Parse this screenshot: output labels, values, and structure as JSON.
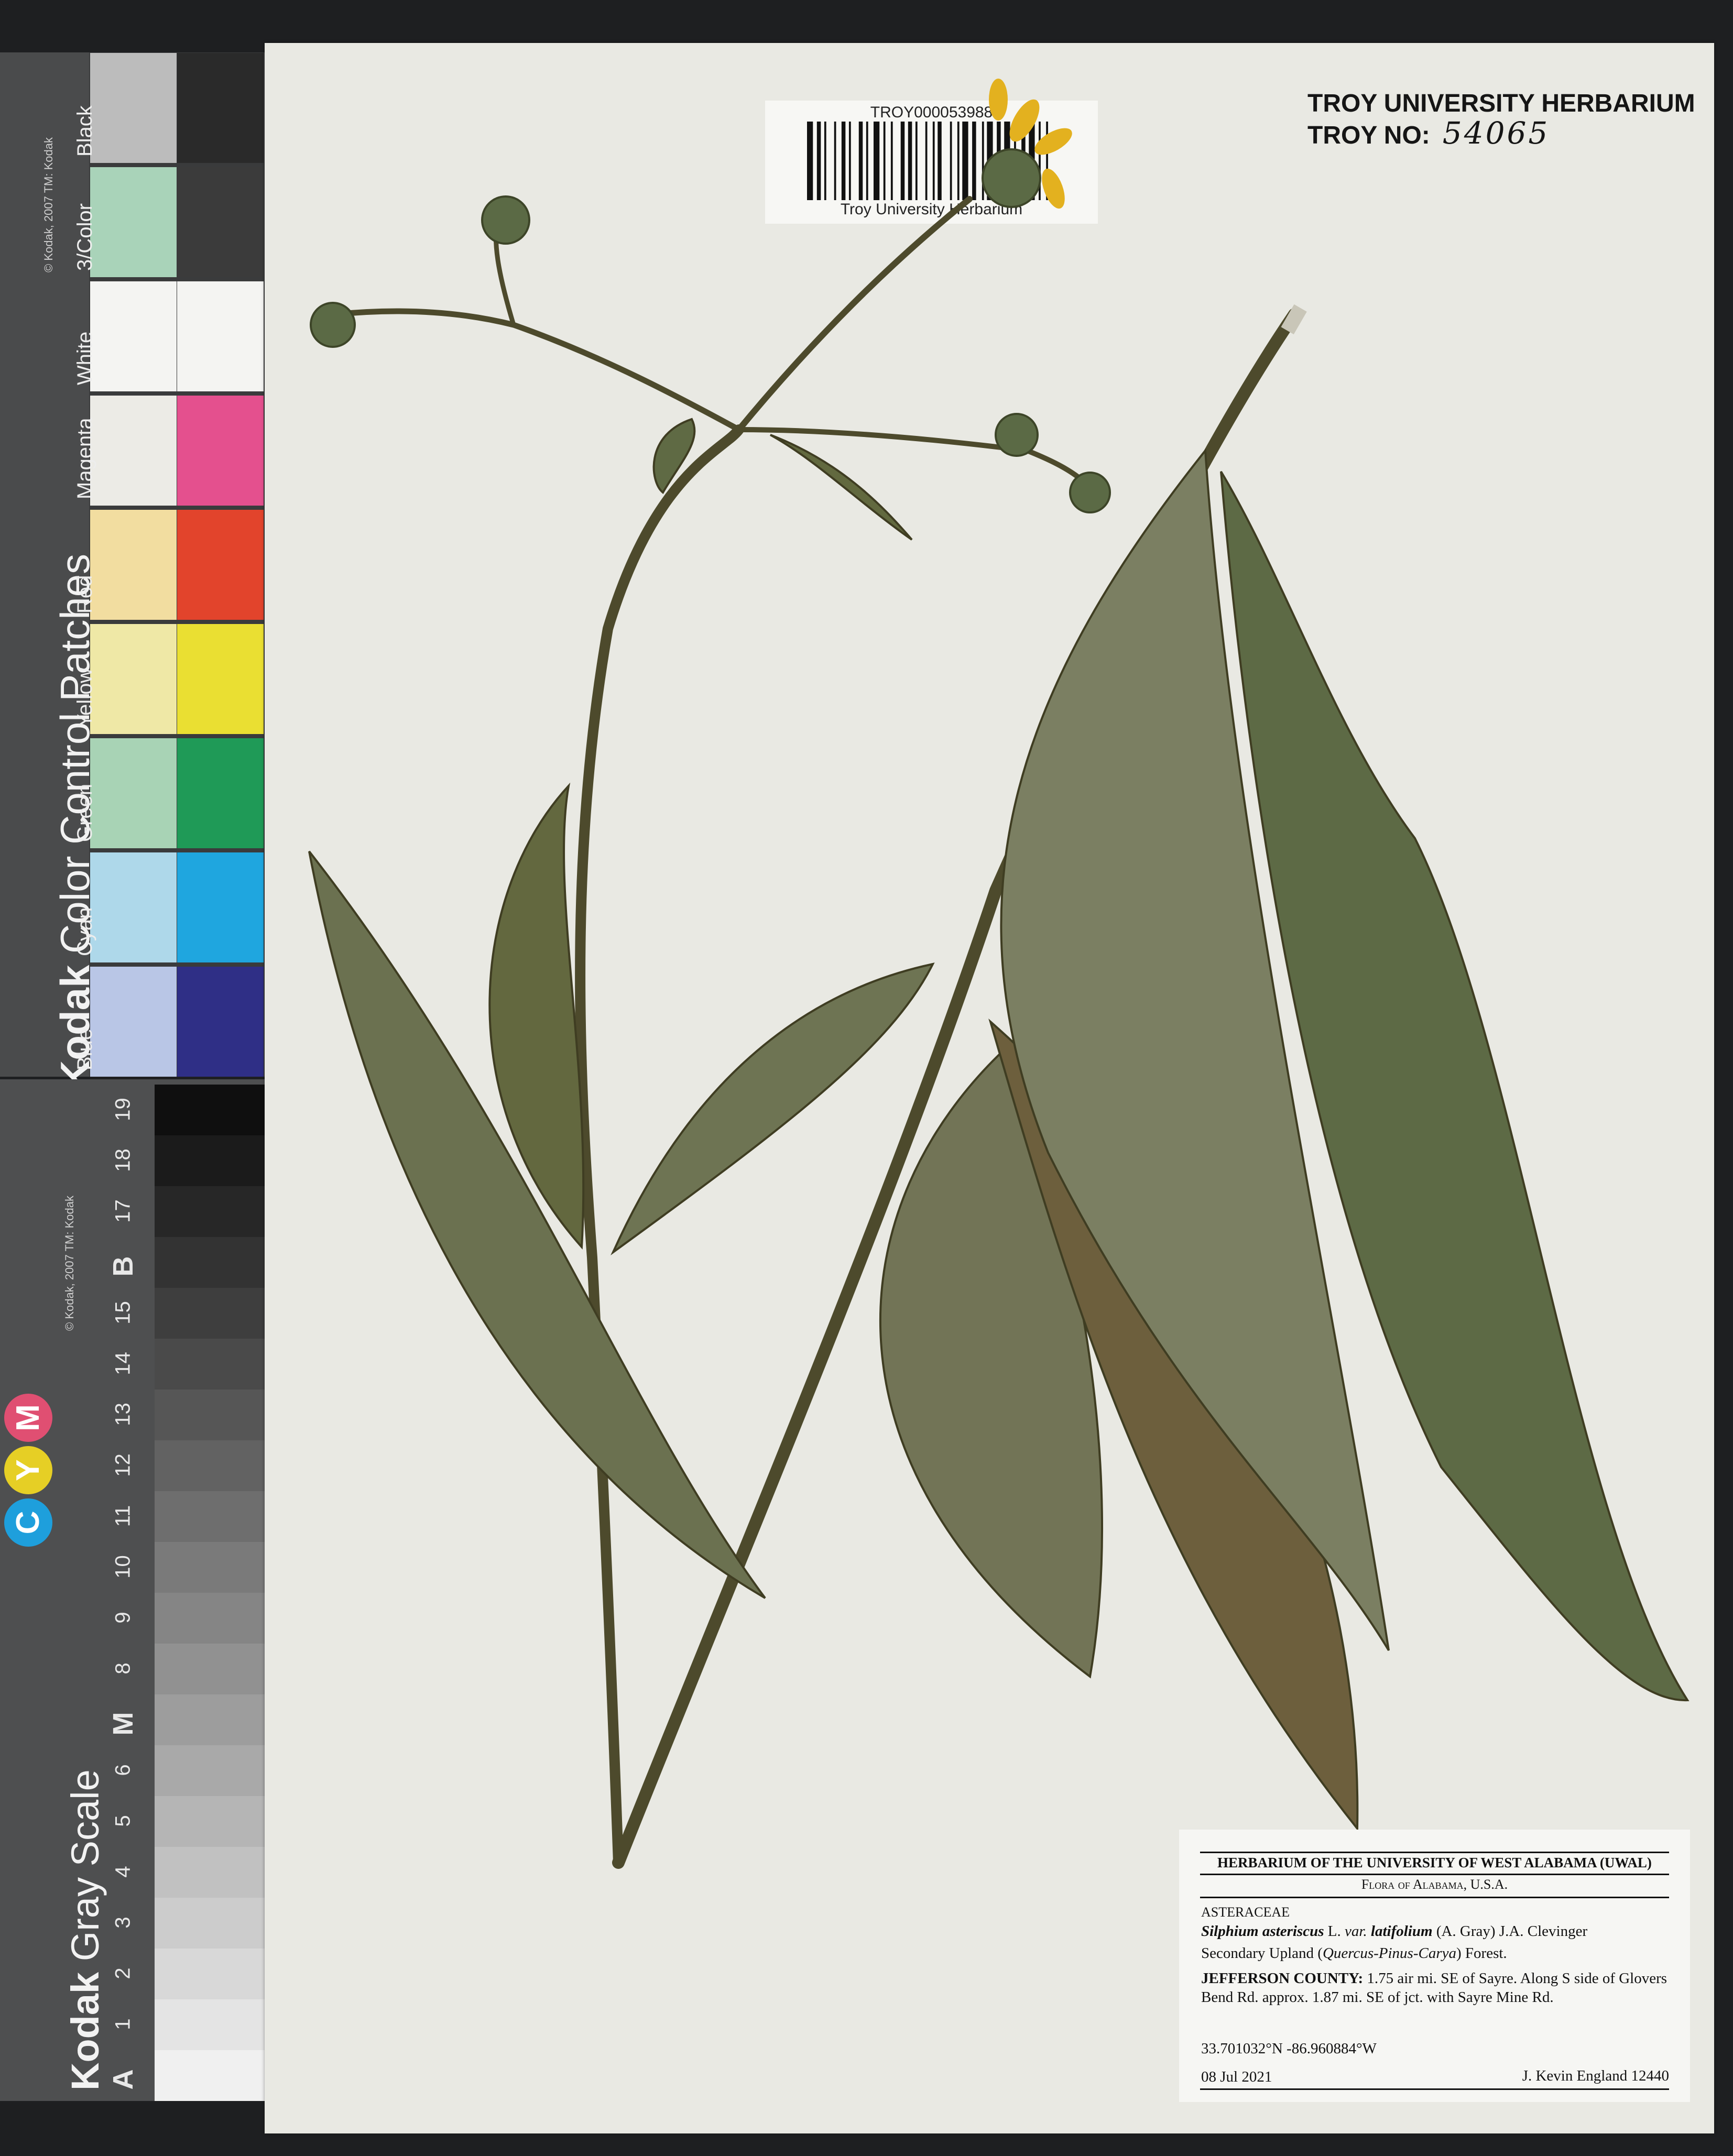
{
  "color_chart": {
    "brand_bold": "Kodak",
    "brand_rest": " Color Control Patches",
    "copyright": "© Kodak, 2007 TM: Kodak",
    "patches": [
      {
        "label": "Blue",
        "light": "#b9c6e6",
        "dark": "#2f2f86"
      },
      {
        "label": "Cyan",
        "light": "#aed8ea",
        "dark": "#1fa6df"
      },
      {
        "label": "Green",
        "light": "#a8d3b5",
        "dark": "#1f9a57"
      },
      {
        "label": "Yellow",
        "light": "#efe8a6",
        "dark": "#eadf32"
      },
      {
        "label": "Red",
        "light": "#f2dda0",
        "dark": "#e2442c"
      },
      {
        "label": "Magenta",
        "light": "#ecebe6",
        "dark": "#e4508e"
      },
      {
        "label": "White",
        "light": "#f4f4f2",
        "dark": "#f4f4f2"
      },
      {
        "label": "3/Color",
        "light": "#a9d3b9",
        "dark": "#3b3b3b"
      },
      {
        "label": "Black",
        "light": "#bcbcbc",
        "dark": "#2a2a2a"
      }
    ]
  },
  "gray_chart": {
    "brand_bold": "Kodak",
    "brand_rest": " Gray Scale",
    "copyright": "© Kodak, 2007 TM: Kodak",
    "steps": [
      "A",
      "1",
      "2",
      "3",
      "4",
      "5",
      "6",
      "M",
      "8",
      "9",
      "10",
      "11",
      "12",
      "13",
      "14",
      "15",
      "B",
      "17",
      "18",
      "19"
    ],
    "cym": [
      {
        "letter": "C",
        "color": "#1e9fdc"
      },
      {
        "letter": "Y",
        "color": "#e6cf25"
      },
      {
        "letter": "M",
        "color": "#e04f72"
      }
    ]
  },
  "barcode": {
    "code": "TROY000053988",
    "institution": "Troy University Herbarium"
  },
  "stamp": {
    "title": "TROY UNIVERSITY HERBARIUM",
    "no_label": "TROY NO:",
    "no_value": "54065"
  },
  "label": {
    "header": "HERBARIUM OF THE UNIVERSITY OF WEST ALABAMA (UWAL)",
    "subheader": "Flora of Alabama, U.S.A.",
    "family": "ASTERACEAE",
    "genus_species": "Silphium asteriscus",
    "author1": " L. ",
    "var": "var.",
    "infra": " latifolium",
    "author2": " (A. Gray) J.A. Clevinger",
    "habitat_pre": "Secondary Upland (",
    "habitat_taxa": "Quercus-Pinus-Carya",
    "habitat_post": ") Forest.",
    "county": "JEFFERSON COUNTY:",
    "locality": "  1.75 air mi. SE of Sayre.  Along S side of Glovers Bend Rd. approx. 1.87 mi. SE of jct. with Sayre Mine Rd.",
    "coords": "33.701032°N -86.960884°W",
    "date": "08 Jul 2021",
    "collector": "J. Kevin England 12440"
  }
}
